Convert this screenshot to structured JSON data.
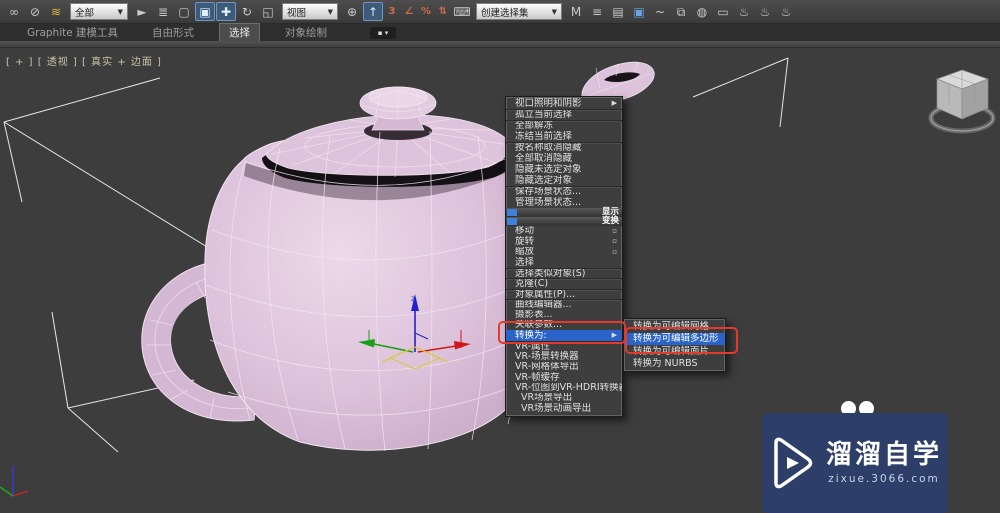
{
  "toolbar": {
    "group1": [
      {
        "glyph": "∞",
        "name": "select-and-link-icon"
      },
      {
        "glyph": "⊘",
        "name": "break-link-icon"
      },
      {
        "glyph": "≋",
        "name": "bind-to-space-warp-icon",
        "classes": "warm"
      }
    ],
    "filter_dropdown": {
      "value": "全部",
      "arrow": "▼"
    },
    "group2": [
      {
        "glyph": "►",
        "name": "select-object-icon"
      },
      {
        "glyph": "≣",
        "name": "select-by-name-icon"
      },
      {
        "glyph": "▢",
        "name": "selection-region-icon"
      },
      {
        "glyph": "▣",
        "name": "window-crossing-toggle-icon",
        "classes": "active"
      },
      {
        "glyph": "✚",
        "name": "select-and-move-icon",
        "classes": "active"
      },
      {
        "glyph": "↻",
        "name": "select-and-rotate-icon"
      },
      {
        "glyph": "◱",
        "name": "select-and-scale-icon"
      }
    ],
    "coord_dropdown": {
      "value": "视图",
      "arrow": "▼"
    },
    "group3": [
      {
        "glyph": "⊕",
        "name": "use-pivot-center-icon"
      },
      {
        "glyph": "↑",
        "name": "select-and-manipulate-icon",
        "classes": "active"
      },
      {
        "glyph": "3",
        "name": "snap-toggle-3d-icon",
        "classes": "snap"
      },
      {
        "glyph": "∠",
        "name": "angle-snap-icon",
        "classes": "snap"
      },
      {
        "glyph": "%",
        "name": "percent-snap-icon",
        "classes": "snap"
      },
      {
        "glyph": "⇅",
        "name": "spinner-snap-icon",
        "classes": "snap"
      },
      {
        "glyph": "⌨",
        "name": "keyboard-override-icon"
      }
    ],
    "selection_set_dropdown": {
      "value": "创建选择集",
      "arrow": "▼"
    },
    "group4": [
      {
        "glyph": "M",
        "name": "mirror-icon"
      },
      {
        "glyph": "≡",
        "name": "align-icon"
      },
      {
        "glyph": "▤",
        "name": "layer-manager-icon"
      },
      {
        "glyph": "▣",
        "name": "scene-explorer-icon",
        "classes": "blue"
      },
      {
        "glyph": "~",
        "name": "curve-editor-icon"
      },
      {
        "glyph": "⧉",
        "name": "schematic-view-icon"
      },
      {
        "glyph": "◍",
        "name": "render-setup-icon"
      },
      {
        "glyph": "▭",
        "name": "rendered-frame-window-icon"
      },
      {
        "glyph": "♨",
        "name": "render-production-icon"
      },
      {
        "glyph": "♨",
        "name": "render-iterative-icon"
      },
      {
        "glyph": "♨",
        "name": "quick-render-icon"
      }
    ]
  },
  "ribbon": {
    "tabs": [
      {
        "label": "Graphite 建模工具",
        "name": "tab-graphite-modeling"
      },
      {
        "label": "自由形式",
        "name": "tab-freeform"
      },
      {
        "label": "选择",
        "classes": "active",
        "name": "tab-selection"
      },
      {
        "label": "对象绘制",
        "name": "tab-object-paint"
      }
    ],
    "min_button_glyph": "▪ ▾"
  },
  "viewport": {
    "label": "[ + ] [ 透视 ] [ 真实 + 边面 ]",
    "gizmo_z_label": "z"
  },
  "context_menu": {
    "quad_title_display": "显示",
    "quad_title_transform": "变换",
    "items_top": [
      {
        "label": "视口照明和阴影",
        "glyph": "▶",
        "name": "menu-item-viewport-lighting-shadows"
      },
      {
        "label": "孤立当前选择",
        "classes": "sep-above",
        "name": "menu-item-isolate-selection"
      },
      {
        "label": "全部解冻",
        "classes": "sep-above",
        "name": "menu-item-unfreeze-all"
      },
      {
        "label": "冻结当前选择",
        "name": "menu-item-freeze-selection"
      },
      {
        "label": "按名称取消隐藏",
        "classes": "sep-above",
        "name": "menu-item-unhide-by-name"
      },
      {
        "label": "全部取消隐藏",
        "name": "menu-item-unhide-all"
      },
      {
        "label": "隐藏未选定对象",
        "name": "menu-item-hide-unselected"
      },
      {
        "label": "隐藏选定对象",
        "name": "menu-item-hide-selection"
      },
      {
        "label": "保存场景状态...",
        "classes": "sep-above",
        "name": "menu-item-save-scene-state"
      },
      {
        "label": "管理场景状态...",
        "name": "menu-item-manage-scene-states"
      }
    ],
    "items_transform": [
      {
        "label": "移动",
        "glyph": "▫",
        "name": "menu-item-move"
      },
      {
        "label": "旋转",
        "glyph": "▫",
        "name": "menu-item-rotate"
      },
      {
        "label": "缩放",
        "glyph": "▫",
        "name": "menu-item-scale"
      },
      {
        "label": "选择",
        "name": "menu-item-select"
      },
      {
        "label": "选择类似对象(S)",
        "classes": "sep-above",
        "name": "menu-item-select-similar"
      },
      {
        "label": "克隆(C)",
        "classes": "sep-above",
        "name": "menu-item-clone"
      },
      {
        "label": "对象属性(P)...",
        "classes": "sep-above",
        "name": "menu-item-object-properties"
      },
      {
        "label": "曲线编辑器...",
        "classes": "sep-above",
        "name": "menu-item-curve-editor"
      },
      {
        "label": "摄影表...",
        "name": "menu-item-dope-sheet"
      },
      {
        "label": "关联参数...",
        "name": "menu-item-wire-parameters"
      },
      {
        "label": "转换为:",
        "glyph": "▶",
        "classes": "highlight",
        "name": "menu-item-convert-to"
      },
      {
        "label": "VR-属性",
        "classes": "sep-above",
        "name": "menu-item-vr-properties"
      },
      {
        "label": "VR-场景转换器",
        "name": "menu-item-vr-scene-converter"
      },
      {
        "label": "VR-网格体导出",
        "name": "menu-item-vr-mesh-export"
      },
      {
        "label": "VR-帧缓存",
        "name": "menu-item-vr-frame-buffer"
      },
      {
        "label": "VR-位图到VR-HDRI转换器",
        "name": "menu-item-vr-bitmap-to-hdri-converter"
      },
      {
        "label": "VR场景导出",
        "classes": "indent",
        "name": "menu-item-vr-scene-export"
      },
      {
        "label": "VR场景动画导出",
        "classes": "indent",
        "name": "menu-item-vr-scene-anim-export"
      }
    ],
    "submenu": [
      {
        "label": "转换为可编辑网格",
        "name": "submenu-item-convert-to-editable-mesh"
      },
      {
        "label": "转换为可编辑多边形",
        "classes": "highlight",
        "name": "submenu-item-convert-to-editable-poly"
      },
      {
        "label": "转换为可编辑面片",
        "name": "submenu-item-convert-to-editable-patch"
      },
      {
        "label": "转换为 NURBS",
        "name": "submenu-item-convert-to-nurbs"
      }
    ]
  },
  "annotation": {
    "color": "#e23b2e"
  },
  "watermark": {
    "title": "溜溜自学",
    "url": "zixue.3066.com"
  }
}
